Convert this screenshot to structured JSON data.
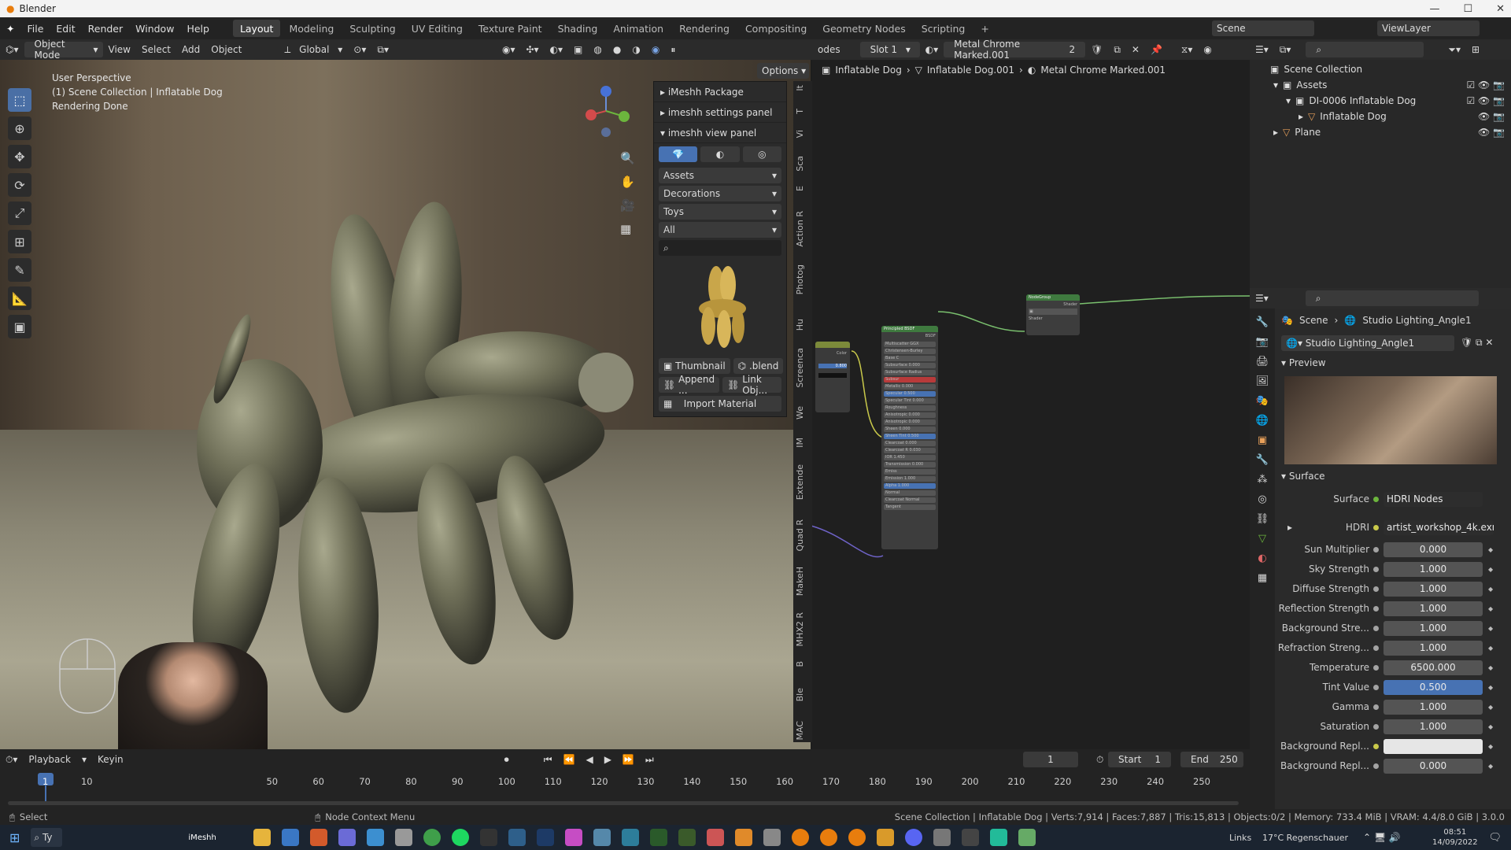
{
  "window": {
    "title": "Blender",
    "controls": [
      "—",
      "☐",
      "✕"
    ]
  },
  "menu": {
    "items": [
      "File",
      "Edit",
      "Render",
      "Window",
      "Help"
    ]
  },
  "workspaces": [
    "Layout",
    "Modeling",
    "Sculpting",
    "UV Editing",
    "Texture Paint",
    "Shading",
    "Animation",
    "Rendering",
    "Compositing",
    "Geometry Nodes",
    "Scripting"
  ],
  "active_workspace": "Layout",
  "scene": {
    "label": "Scene",
    "viewlayer": "ViewLayer"
  },
  "viewport_header": {
    "mode": "Object Mode",
    "menus": [
      "View",
      "Select",
      "Add",
      "Object"
    ],
    "orientation": "Global",
    "options": "Options"
  },
  "viewport_info": {
    "line1": "User Perspective",
    "line2": "(1) Scene Collection | Inflatable Dog",
    "line3": "Rendering Done"
  },
  "npanel": {
    "package": "iMeshh Package",
    "settings": "imeshh settings panel",
    "view": "imeshh view panel",
    "dropdowns": [
      "Assets",
      "Decorations",
      "Toys",
      "All"
    ],
    "thumbnail": "Thumbnail",
    "blend": ".blend",
    "append": "Append ...",
    "link": "Link Obj...",
    "import": "Import Material"
  },
  "side_tabs": [
    "It",
    "T",
    "Vi",
    "Sca",
    "E",
    "Action R",
    "Photog",
    "Hu",
    "Screenca",
    "We",
    "IM",
    "Extende",
    "Quad R",
    "MakeH",
    "MHX2 R",
    "B",
    "Ble",
    "MAC"
  ],
  "node_header": {
    "slot": "Slot 1",
    "material": "Metal Chrome Marked.001",
    "users": "2",
    "odes": "odes"
  },
  "breadcrumb": [
    "Inflatable Dog",
    "Inflatable Dog.001",
    "Metal Chrome Marked.001"
  ],
  "nodes": {
    "bsdf": "Principled BSDF",
    "group": "NodeGroup",
    "bsdf_out": "BSDF",
    "shader": "Shader",
    "rows": [
      "Multiscatter GGX",
      "Christensen-Burley",
      "Base C",
      "Subsurface 0.000",
      "Subsurface Radius",
      "Subsur",
      "Metallic 0.000",
      "Specular 0.500",
      "Specular Tint 0.000",
      "Roughness",
      "Anisotropic 0.000",
      "Anisotropic 0.000",
      "Sheen 0.000",
      "Sheen Tint 0.500",
      "Clearcoat 0.000",
      "Clearcoat R 0.030",
      "IOR 1.450",
      "Transmission 0.000",
      "Emiss",
      "Emission 1.000",
      "Alpha 1.000",
      "Normal",
      "Clearcoat Normal",
      "Tangent"
    ],
    "color": "Color",
    "value": "0.800"
  },
  "outliner": {
    "root": "Scene Collection",
    "items": [
      {
        "name": "Assets",
        "level": 1
      },
      {
        "name": "DI-0006 Inflatable Dog",
        "level": 2
      },
      {
        "name": "Inflatable Dog",
        "level": 3
      },
      {
        "name": "Plane",
        "level": 1
      }
    ]
  },
  "properties": {
    "breadcrumb_scene": "Scene",
    "breadcrumb_world": "Studio Lighting_Angle1",
    "world_name": "Studio Lighting_Angle1",
    "preview_label": "Preview",
    "surface_label": "Surface",
    "surface_row": {
      "label": "Surface",
      "value": "HDRI Nodes"
    },
    "hdri_row": {
      "label": "HDRI",
      "value": "artist_workshop_4k.exr..."
    },
    "rows": [
      {
        "label": "Sun Multiplier",
        "value": "0.000"
      },
      {
        "label": "Sky Strength",
        "value": "1.000"
      },
      {
        "label": "Diffuse Strength",
        "value": "1.000"
      },
      {
        "label": "Reflection Strength",
        "value": "1.000"
      },
      {
        "label": "Background Stre...",
        "value": "1.000"
      },
      {
        "label": "Refraction Streng...",
        "value": "1.000"
      },
      {
        "label": "Temperature",
        "value": "6500.000"
      },
      {
        "label": "Tint Value",
        "value": "0.500"
      },
      {
        "label": "Gamma",
        "value": "1.000"
      },
      {
        "label": "Saturation",
        "value": "1.000"
      },
      {
        "label": "Background Repl...",
        "value": ""
      },
      {
        "label": "Background Repl...",
        "value": "0.000"
      }
    ]
  },
  "timeline": {
    "playback": "Playback",
    "keying": "Keyin",
    "current_frame": "1",
    "start_label": "Start",
    "start": "1",
    "end_label": "End",
    "end": "250",
    "ticks": [
      "1",
      "10",
      "50",
      "60",
      "70",
      "80",
      "90",
      "100",
      "110",
      "120",
      "130",
      "140",
      "150",
      "160",
      "170",
      "180",
      "190",
      "200",
      "210",
      "220",
      "230",
      "240",
      "250"
    ]
  },
  "status": {
    "select": "Select",
    "context": "Node Context Menu",
    "stats": "Scene Collection | Inflatable Dog | Verts:7,914 | Faces:7,887 | Tris:15,813 | Objects:0/2 | Memory: 733.4 MiB | VRAM: 4.4/8.0 GiB | 3.0.0"
  },
  "taskbar": {
    "search": "Ty",
    "links": "Links",
    "weather": "17°C Regenschauer",
    "time": "08:51",
    "date": "14/09/2022",
    "brand": "iMeshh"
  },
  "colors": {
    "accent": "#4a6fa5",
    "tint_bar": "#4772b3",
    "red": "#c94444"
  }
}
